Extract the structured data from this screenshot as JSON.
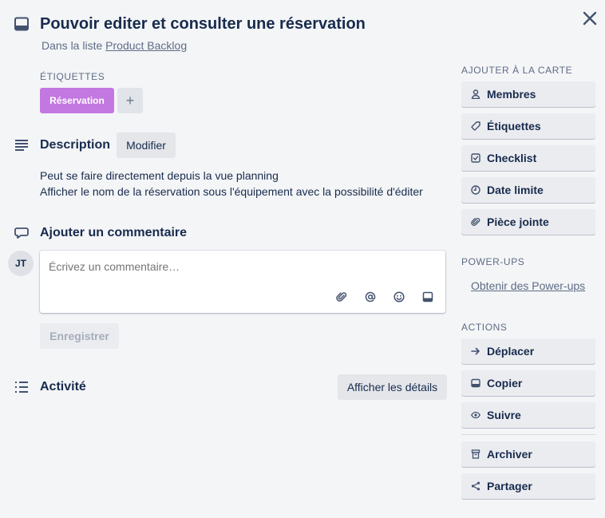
{
  "card": {
    "title": "Pouvoir editer et consulter une réservation",
    "in_list_prefix": "Dans la liste",
    "list_name": "Product Backlog"
  },
  "labels": {
    "heading": "Étiquettes",
    "items": [
      {
        "name": "Réservation",
        "color": "#c377e0"
      }
    ],
    "add_symbol": "+"
  },
  "description": {
    "title": "Description",
    "edit_label": "Modifier",
    "lines": [
      "Peut se faire directement depuis la vue planning",
      "Afficher le nom de la réservation sous l'équipement avec la possibilité d'éditer"
    ]
  },
  "comment": {
    "title": "Ajouter un commentaire",
    "avatar_initials": "JT",
    "placeholder": "Écrivez un commentaire…",
    "save_label": "Enregistrer",
    "tools": [
      "attachment-icon",
      "mention-icon",
      "emoji-icon",
      "card-icon"
    ]
  },
  "activity": {
    "title": "Activité",
    "show_details_label": "Afficher les détails"
  },
  "sidebar": {
    "add_heading": "Ajouter à la carte",
    "add_items": [
      {
        "label": "Membres",
        "icon": "person-icon"
      },
      {
        "label": "Étiquettes",
        "icon": "tag-icon"
      },
      {
        "label": "Checklist",
        "icon": "checklist-icon"
      },
      {
        "label": "Date limite",
        "icon": "clock-icon"
      },
      {
        "label": "Pièce jointe",
        "icon": "paperclip-icon"
      }
    ],
    "powerups_heading": "Power-Ups",
    "get_powerups": "Obtenir des Power-ups",
    "actions_heading": "Actions",
    "actions": [
      {
        "label": "Déplacer",
        "icon": "arrow-right-icon"
      },
      {
        "label": "Copier",
        "icon": "card-icon"
      },
      {
        "label": "Suivre",
        "icon": "eye-icon"
      },
      {
        "label": "Archiver",
        "icon": "archive-icon"
      },
      {
        "label": "Partager",
        "icon": "share-icon"
      }
    ]
  },
  "colors": {
    "background": "#f4f5f7",
    "text": "#172b4d",
    "muted": "#5e6c84",
    "button": "#ebecf0"
  }
}
